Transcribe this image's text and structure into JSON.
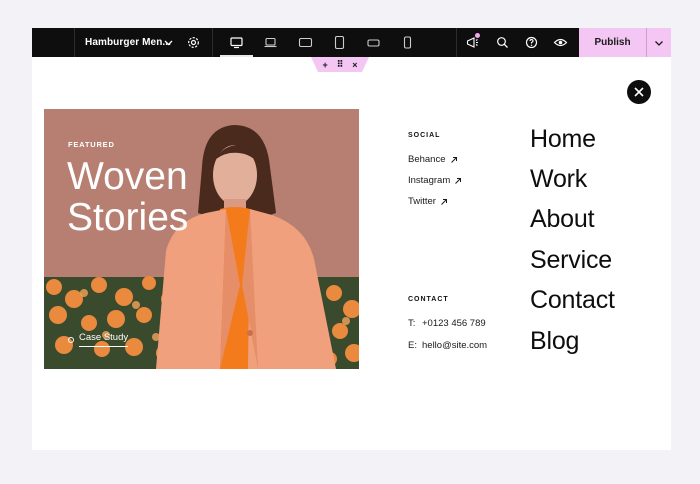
{
  "toolbar": {
    "document_title": "Hamburger Men...",
    "publish_label": "Publish",
    "icons": [
      "settings-icon",
      "desktop-icon",
      "laptop-icon",
      "tablet-landscape-icon",
      "tablet-portrait-icon",
      "mobile-landscape-icon",
      "mobile-portrait-icon",
      "notifications-icon",
      "search-icon",
      "help-icon",
      "preview-icon"
    ]
  },
  "section_handle": {
    "add": "+",
    "drag": "⠿",
    "remove": "×"
  },
  "hero": {
    "eyebrow": "FEATURED",
    "title_line1": "Woven",
    "title_line2": "Stories",
    "link_label": "Case Study"
  },
  "social": {
    "heading": "SOCIAL",
    "links": [
      {
        "label": "Behance"
      },
      {
        "label": "Instagram"
      },
      {
        "label": "Twitter"
      }
    ]
  },
  "contact": {
    "heading": "CONTACT",
    "phone_prefix": "T:",
    "phone": "+0123 456 789",
    "email_prefix": "E:",
    "email": "hello@site.com"
  },
  "nav": {
    "items": [
      "Home",
      "Work",
      "About",
      "Service",
      "Contact",
      "Blog"
    ]
  },
  "colors": {
    "toolbar_bg": "#0e0e0e",
    "accent": "#f4c6f4",
    "hero_bg": "#b77f72",
    "coat": "#f0a07c",
    "sweater": "#f47b1c"
  }
}
